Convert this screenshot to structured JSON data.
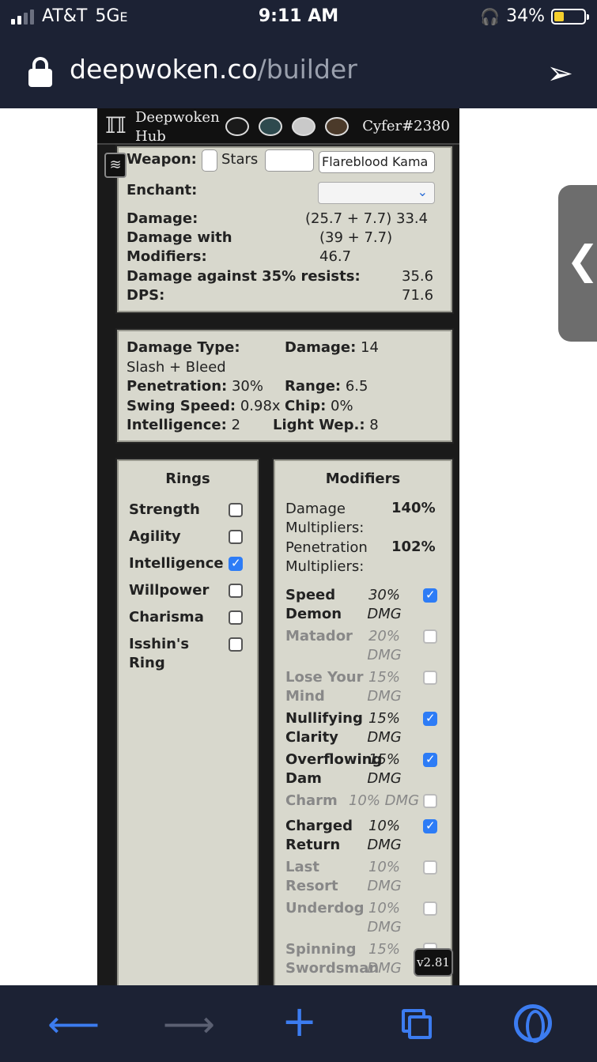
{
  "status_bar": {
    "carrier": "AT&T",
    "network": "5G",
    "network_suffix": "E",
    "time": "9:11 AM",
    "battery": "34%",
    "battery_level": 0.34
  },
  "browser": {
    "url_host": "deepwoken.co",
    "url_path": "/builder",
    "share_icon": "share-arrow-icon",
    "side_tab_glyph": "❮"
  },
  "app": {
    "brand_line1": "Deepwoken",
    "brand_line2": "Hub",
    "logo_glyph": "ℿ",
    "themes": [
      "#1a1a1a",
      "#2e4a4e",
      "#c9c9c9",
      "#4b3a2a"
    ],
    "user_tag": "Cyfer#2380",
    "menu_glyph": "≋",
    "version": "v2.81"
  },
  "weapon": {
    "weapon_label": "Weapon:",
    "stars_label": "Stars",
    "weapon_value": "Flareblood Kama",
    "enchant_label": "Enchant:",
    "enchant_value": "",
    "damage_label": "Damage:",
    "damage_value": "(25.7 + 7.7) 33.4",
    "dmg_mod_label1": "Damage with",
    "dmg_mod_label2": "Modifiers:",
    "dmg_mod_value1": "(39 + 7.7)",
    "dmg_mod_value2": "46.7",
    "resist_label": "Damage against 35% resists:",
    "resist_value": "35.6",
    "dps_label": "DPS:",
    "dps_value": "71.6"
  },
  "stats": {
    "damage_type_label": "Damage Type:",
    "damage_type_value": "Slash + Bleed",
    "damage_label": "Damage:",
    "damage_value": "14",
    "penetration_label": "Penetration:",
    "penetration_value": "30%",
    "range_label": "Range:",
    "range_value": "6.5",
    "swing_label": "Swing Speed:",
    "swing_value": "0.98x",
    "chip_label": "Chip:",
    "chip_value": "0%",
    "int_label": "Intelligence:",
    "int_value": "2",
    "light_label": "Light Wep.:",
    "light_value": "8"
  },
  "rings": {
    "title": "Rings",
    "items": [
      {
        "label": "Strength",
        "checked": false
      },
      {
        "label": "Agility",
        "checked": false
      },
      {
        "label": "Intelligence",
        "checked": true
      },
      {
        "label": "Willpower",
        "checked": false
      },
      {
        "label": "Charisma",
        "checked": false
      },
      {
        "label": "Isshin's\nRing",
        "checked": false
      }
    ]
  },
  "modifiers": {
    "title": "Modifiers",
    "dmg_mult_label1": "Damage",
    "dmg_mult_label2": "Multipliers:",
    "dmg_mult_value": "140%",
    "pen_mult_label1": "Penetration",
    "pen_mult_label2": "Multipliers:",
    "pen_mult_value": "102%",
    "items": [
      {
        "name": "Speed\nDemon",
        "value": "30%\nDMG",
        "checked": true
      },
      {
        "name": "Matador",
        "value": "20%\nDMG",
        "checked": false
      },
      {
        "name": "Lose Your\nMind",
        "value": "15%\nDMG",
        "checked": false
      },
      {
        "name": "Nullifying\nClarity",
        "value": "15%\nDMG",
        "checked": true
      },
      {
        "name": "Overflowing\nDam",
        "value": "15%\nDMG",
        "checked": true
      },
      {
        "name": "Charm",
        "value": "10% DMG",
        "checked": false
      },
      {
        "name": "Charged\nReturn",
        "value": "10%\nDMG",
        "checked": true
      },
      {
        "name": "Last\nResort",
        "value": "10%\nDMG",
        "checked": false
      },
      {
        "name": "Underdog",
        "value": "10%\nDMG",
        "checked": false
      },
      {
        "name": "Spinning\nSwordsman",
        "value": "15%\nDMG",
        "checked": false
      }
    ]
  }
}
